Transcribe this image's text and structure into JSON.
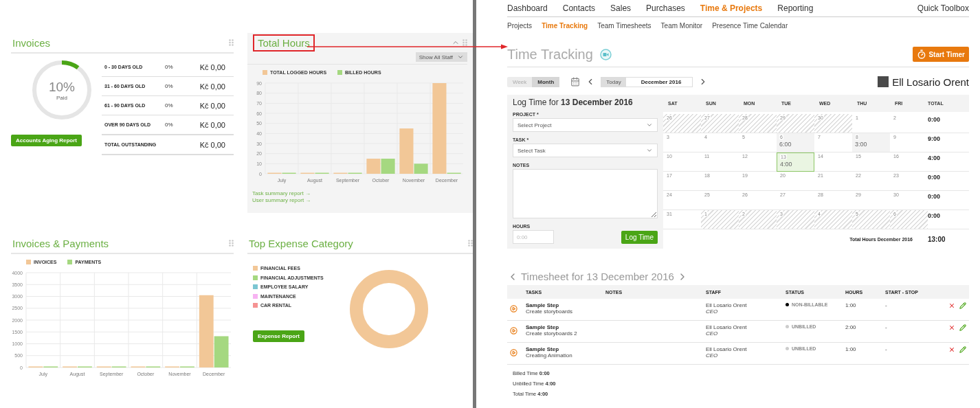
{
  "invoices": {
    "title": "Invoices",
    "ring": {
      "level": 0.1,
      "percent": "10%",
      "caption": "Paid"
    },
    "button": "Accounts Aging Report",
    "aging": [
      {
        "label": "0 - 30 DAYS OLD",
        "percent": "0%",
        "amount": "Kč 0,00"
      },
      {
        "label": "31 - 60 DAYS OLD",
        "percent": "0%",
        "amount": "Kč 0,00"
      },
      {
        "label": "61 - 90 DAYS OLD",
        "percent": "0%",
        "amount": "Kč 0,00"
      },
      {
        "label": "OVER 90 DAYS OLD",
        "percent": "0%",
        "amount": "Kč 0,00"
      },
      {
        "label": "TOTAL OUTSTANDING",
        "amount": "Kč 0,00"
      }
    ]
  },
  "total_hours": {
    "title": "Total Hours",
    "highlighted": true,
    "staff_filter": "Show All Staff",
    "chart_data": {
      "type": "bar",
      "categories": [
        "July",
        "August",
        "September",
        "October",
        "November",
        "December"
      ],
      "series": [
        {
          "name": "TOTAL LOGGED HOURS",
          "color": "#f2c797",
          "values": [
            0,
            0,
            0,
            15,
            45,
            90
          ]
        },
        {
          "name": "BILLED HOURS",
          "color": "#a5d880",
          "values": [
            0,
            0,
            0,
            15,
            10,
            0
          ]
        }
      ],
      "grid": true,
      "ylim": [
        0,
        90
      ],
      "yticks": [
        0,
        10,
        20,
        30,
        40,
        50,
        60,
        70,
        80,
        90
      ]
    },
    "links": [
      "Task summary report →",
      "User summary report →"
    ]
  },
  "invoices_payments": {
    "title": "Invoices & Payments",
    "chart_data": {
      "type": "bar",
      "categories": [
        "July",
        "August",
        "September",
        "October",
        "November",
        "December"
      ],
      "series": [
        {
          "name": "INVOICES",
          "color": "#f2c797",
          "values": [
            0,
            0,
            0,
            0,
            0,
            3050
          ]
        },
        {
          "name": "PAYMENTS",
          "color": "#a5d880",
          "values": [
            0,
            0,
            0,
            0,
            0,
            1320
          ]
        }
      ],
      "grid": true,
      "ylim": [
        0,
        4000
      ],
      "yticks": [
        0,
        500,
        1000,
        1500,
        2000,
        2500,
        3000,
        3500,
        4000
      ]
    }
  },
  "top_expense": {
    "title": "Top Expense Category",
    "button": "Expense Report",
    "legend": [
      {
        "name": "FINANCIAL FEES",
        "color": "#f2c797"
      },
      {
        "name": "FINANCIAL ADJUSTMENTS",
        "color": "#a5d880"
      },
      {
        "name": "EMPLOYEE SALARY",
        "color": "#7cc6d2"
      },
      {
        "name": "MAINTENANCE",
        "color": "#f7b3f2"
      },
      {
        "name": "CAR RENTAL",
        "color": "#f59393"
      }
    ]
  },
  "nav": {
    "items": [
      {
        "label": "Dashboard",
        "selected": false
      },
      {
        "label": "Contacts",
        "selected": false
      },
      {
        "label": "Sales",
        "selected": false
      },
      {
        "label": "Purchases",
        "selected": false
      },
      {
        "label": "Time & Projects",
        "selected": true
      },
      {
        "label": "Reporting",
        "selected": false
      }
    ],
    "quick_toolbox": "Quick Toolbox"
  },
  "subnav": [
    {
      "label": "Projects",
      "selected": false
    },
    {
      "label": "Time Tracking",
      "selected": true
    },
    {
      "label": "Team Timesheets",
      "selected": false
    },
    {
      "label": "Team Monitor",
      "selected": false
    },
    {
      "label": "Presence Time Calendar",
      "selected": false
    }
  ],
  "page_title": "Time Tracking",
  "start_timer": "Start Timer",
  "view_toggle": [
    {
      "label": "Week",
      "selected": false
    },
    {
      "label": "Month",
      "selected": true
    }
  ],
  "today": "Today",
  "period": "December 2016",
  "user": "Ell Losario Orent",
  "log_form": {
    "title": "Log Time for **13 December 2016**",
    "project_label": "PROJECT *",
    "project_value": "Select Project",
    "task_label": "TASK *",
    "task_value": "Select Task",
    "notes_label": "NOTES",
    "hours_label": "HOURS",
    "hours_placeholder": "0:00",
    "submit": "Log Time"
  },
  "calendar": {
    "days": [
      "SAT",
      "SUN",
      "MON",
      "TUE",
      "WED",
      "THU",
      "FRI"
    ],
    "total_heading": "TOTAL",
    "weeks": [
      {
        "total": "0:00",
        "cells": [
          {
            "day": "26",
            "outside": true,
            "selected": false
          },
          {
            "day": "27",
            "outside": true,
            "selected": false
          },
          {
            "day": "28",
            "outside": true,
            "selected": false
          },
          {
            "day": "29",
            "outside": true,
            "selected": false
          },
          {
            "day": "30",
            "outside": true,
            "selected": false
          },
          {
            "day": "1",
            "outside": false,
            "selected": false
          },
          {
            "day": "2",
            "outside": false,
            "selected": false
          }
        ]
      },
      {
        "total": "9:00",
        "cells": [
          {
            "day": "3",
            "outside": false,
            "selected": false
          },
          {
            "day": "4",
            "outside": false,
            "selected": false
          },
          {
            "day": "5",
            "outside": false,
            "selected": false
          },
          {
            "day": "6",
            "outside": false,
            "selected": false,
            "hours": "6:00"
          },
          {
            "day": "7",
            "outside": false,
            "selected": false
          },
          {
            "day": "8",
            "outside": false,
            "selected": false,
            "hours": "3:00"
          },
          {
            "day": "9",
            "outside": false,
            "selected": false
          }
        ]
      },
      {
        "total": "4:00",
        "cells": [
          {
            "day": "10",
            "outside": false,
            "selected": false
          },
          {
            "day": "11",
            "outside": false,
            "selected": false
          },
          {
            "day": "12",
            "outside": false,
            "selected": false
          },
          {
            "day": "13",
            "outside": false,
            "selected": true,
            "hours": "4:00"
          },
          {
            "day": "14",
            "outside": false,
            "selected": false
          },
          {
            "day": "15",
            "outside": false,
            "selected": false
          },
          {
            "day": "16",
            "outside": false,
            "selected": false
          }
        ]
      },
      {
        "total": "0:00",
        "cells": [
          {
            "day": "17",
            "outside": false,
            "selected": false
          },
          {
            "day": "18",
            "outside": false,
            "selected": false
          },
          {
            "day": "19",
            "outside": false,
            "selected": false
          },
          {
            "day": "20",
            "outside": false,
            "selected": false
          },
          {
            "day": "21",
            "outside": false,
            "selected": false
          },
          {
            "day": "22",
            "outside": false,
            "selected": false
          },
          {
            "day": "23",
            "outside": false,
            "selected": false
          }
        ]
      },
      {
        "total": "0:00",
        "cells": [
          {
            "day": "24",
            "outside": false,
            "selected": false
          },
          {
            "day": "25",
            "outside": false,
            "selected": false
          },
          {
            "day": "26",
            "outside": false,
            "selected": false
          },
          {
            "day": "27",
            "outside": false,
            "selected": false
          },
          {
            "day": "28",
            "outside": false,
            "selected": false
          },
          {
            "day": "29",
            "outside": false,
            "selected": false
          },
          {
            "day": "30",
            "outside": false,
            "selected": false
          }
        ]
      },
      {
        "total": "0:00",
        "cells": [
          {
            "day": "31",
            "outside": false,
            "selected": false
          },
          {
            "day": "1",
            "outside": true,
            "selected": false
          },
          {
            "day": "2",
            "outside": true,
            "selected": false
          },
          {
            "day": "3",
            "outside": true,
            "selected": false
          },
          {
            "day": "4",
            "outside": true,
            "selected": false
          },
          {
            "day": "5",
            "outside": true,
            "selected": false
          },
          {
            "day": "6",
            "outside": true,
            "selected": false
          }
        ]
      }
    ],
    "footer_label": "Total Hours December 2016",
    "footer_total": "13:00"
  },
  "timesheet": {
    "title": "Timesheet for 13 December 2016",
    "columns": [
      "TASKS",
      "NOTES",
      "STAFF",
      "STATUS",
      "HOURS",
      "START - STOP"
    ],
    "rows": [
      {
        "task": "Sample Step",
        "subtask": "Create storyboards",
        "staff": "Ell Losario Orent",
        "role": "CEO",
        "status": "NON-BILLABLE",
        "color": "#000000",
        "hours": "1:00",
        "start_stop": "-"
      },
      {
        "task": "Sample Step",
        "subtask": "Create storyboards 2",
        "staff": "Ell Losario Orent",
        "role": "CEO",
        "status": "UNBILLED",
        "color": "#cccccc",
        "hours": "2:00",
        "start_stop": "-"
      },
      {
        "task": "Sample Step",
        "subtask": "Creating Animation",
        "staff": "Ell Losario Orent",
        "role": "CEO",
        "status": "UNBILLED",
        "color": "#cccccc",
        "hours": "1:00",
        "start_stop": "-"
      }
    ],
    "summary": [
      "Billed Time **0:00**",
      "Unbilled Time **4:00**",
      "Total Time **4:00**"
    ]
  }
}
